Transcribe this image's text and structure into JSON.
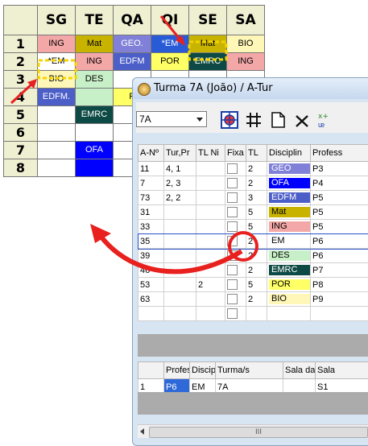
{
  "timetable": {
    "columns": [
      "SG",
      "TE",
      "QA",
      "QI",
      "SE",
      "SA"
    ],
    "rows": [
      {
        "label": "1",
        "cells": [
          {
            "text": "ING",
            "bg": "#f4a7a7"
          },
          {
            "text": "Mat",
            "bg": "#c8b400"
          },
          {
            "text": "GEO.",
            "bg": "#8080d8",
            "color": "#ffffff"
          },
          {
            "text": "*EM",
            "bg": "#2a5bd7",
            "color": "#ffffff"
          },
          {
            "text": "Mat",
            "bg": "#c8b400"
          },
          {
            "text": "BIO",
            "bg": "#fff7b8"
          }
        ]
      },
      {
        "label": "2",
        "cells": [
          {
            "text": "*EM",
            "bg": "#ffffff"
          },
          {
            "text": "ING",
            "bg": "#f4a7a7"
          },
          {
            "text": "EDFM",
            "bg": "#4c5ec8",
            "color": "#ffffff"
          },
          {
            "text": "POR",
            "bg": "#ffff66"
          },
          {
            "text": "EMRC",
            "bg": "#0e4a45",
            "color": "#ffffff"
          },
          {
            "text": "ING",
            "bg": "#f4a7a7"
          }
        ]
      },
      {
        "label": "3",
        "cells": [
          {
            "text": "BIO",
            "bg": "#fff7b8"
          },
          {
            "text": "DES",
            "bg": "#c8f0c8"
          },
          {
            "text": "",
            "bg": "#ffffff"
          },
          {
            "text": "",
            "bg": "#ffffff"
          },
          {
            "text": "",
            "bg": "#ffffff"
          },
          {
            "text": "",
            "bg": "#ffffff"
          }
        ]
      },
      {
        "label": "4",
        "cells": [
          {
            "text": "EDFM.",
            "bg": "#4c5ec8",
            "color": "#ffffff"
          },
          {
            "text": "",
            "bg": "#c8f0c8"
          },
          {
            "text": "P",
            "bg": "#ffff66"
          },
          {
            "text": "",
            "bg": "#ffffff"
          },
          {
            "text": "",
            "bg": "#ffffff"
          },
          {
            "text": "",
            "bg": "#ffffff"
          }
        ]
      },
      {
        "label": "5",
        "cells": [
          {
            "text": "",
            "bg": "#ffffff"
          },
          {
            "text": "EMRC",
            "bg": "#0e4a45",
            "color": "#ffffff"
          },
          {
            "text": "",
            "bg": "#ffffff"
          },
          {
            "text": "",
            "bg": "#ffffff"
          },
          {
            "text": "",
            "bg": "#ffffff"
          },
          {
            "text": "",
            "bg": "#ffffff"
          }
        ]
      },
      {
        "label": "6",
        "cells": [
          {
            "text": "",
            "bg": "#ffffff"
          },
          {
            "text": "",
            "bg": "#ffffff"
          },
          {
            "text": "",
            "bg": "#ffffff"
          },
          {
            "text": "",
            "bg": "#ffffff"
          },
          {
            "text": "",
            "bg": "#ffffff"
          },
          {
            "text": "",
            "bg": "#ffffff"
          }
        ]
      },
      {
        "label": "7",
        "cells": [
          {
            "text": "",
            "bg": "#ffffff"
          },
          {
            "text": "OFA",
            "bg": "#0000ff",
            "color": "#ffffff"
          },
          {
            "text": "",
            "bg": "#ffffff"
          },
          {
            "text": "",
            "bg": "#ffffff"
          },
          {
            "text": "",
            "bg": "#ffffff"
          },
          {
            "text": "",
            "bg": "#ffffff"
          }
        ]
      },
      {
        "label": "8",
        "cells": [
          {
            "text": "",
            "bg": "#ffffff"
          },
          {
            "text": "",
            "bg": "#0000ff"
          },
          {
            "text": "",
            "bg": "#ffffff"
          },
          {
            "text": "",
            "bg": "#ffffff"
          },
          {
            "text": "",
            "bg": "#ffffff"
          },
          {
            "text": "",
            "bg": "#ffffff"
          }
        ]
      }
    ]
  },
  "dialog": {
    "title": "Turma 7A (João) / A-Tur",
    "class_select": "7A",
    "toolbar_icons": [
      "target-grid-icon",
      "hash-grid-icon",
      "new-document-icon",
      "delete-x-icon",
      "swap-icon"
    ],
    "lessons_headers": [
      "A-Nº",
      "Tur,Pr",
      "TL Ni",
      "Fixa",
      "TL",
      "Disciplin",
      "Profess"
    ],
    "lessons": [
      {
        "num": "11",
        "turpr": "4, 1",
        "tlni": "",
        "fixed": false,
        "tl": "2",
        "subject": "GEO",
        "subject_bg": "#8080d8",
        "subject_color": "#ffffff",
        "teacher": "P3"
      },
      {
        "num": "7",
        "turpr": "2, 3",
        "tlni": "",
        "fixed": false,
        "tl": "2",
        "subject": "OFA",
        "subject_bg": "#0000ff",
        "subject_color": "#ffffff",
        "teacher": "P4"
      },
      {
        "num": "73",
        "turpr": "2, 2",
        "tlni": "",
        "fixed": false,
        "tl": "3",
        "subject": "EDFM",
        "subject_bg": "#4c5ec8",
        "subject_color": "#ffffff",
        "teacher": "P5"
      },
      {
        "num": "31",
        "turpr": "",
        "tlni": "",
        "fixed": false,
        "tl": "5",
        "subject": "Mat",
        "subject_bg": "#c8b400",
        "subject_color": "#000000",
        "teacher": "P5"
      },
      {
        "num": "33",
        "turpr": "",
        "tlni": "",
        "fixed": false,
        "tl": "5",
        "subject": "ING",
        "subject_bg": "#f4a7a7",
        "subject_color": "#000000",
        "teacher": "P5"
      },
      {
        "num": "35",
        "turpr": "",
        "tlni": "",
        "fixed": true,
        "tl": "2",
        "subject": "EM",
        "subject_bg": "#ffffff",
        "subject_color": "#000000",
        "teacher": "P6"
      },
      {
        "num": "39",
        "turpr": "",
        "tlni": "",
        "fixed": false,
        "tl": "2",
        "subject": "DES",
        "subject_bg": "#c8f0c8",
        "subject_color": "#000000",
        "teacher": "P6"
      },
      {
        "num": "46",
        "turpr": "",
        "tlni": "",
        "fixed": false,
        "tl": "2",
        "subject": "EMRC",
        "subject_bg": "#0e4a45",
        "subject_color": "#ffffff",
        "teacher": "P7"
      },
      {
        "num": "53",
        "turpr": "",
        "tlni": "2",
        "fixed": false,
        "tl": "5",
        "subject": "POR",
        "subject_bg": "#ffff66",
        "subject_color": "#000000",
        "teacher": "P8"
      },
      {
        "num": "63",
        "turpr": "",
        "tlni": "",
        "fixed": false,
        "tl": "2",
        "subject": "BIO",
        "subject_bg": "#fff7b8",
        "subject_color": "#000000",
        "teacher": "P9"
      },
      {
        "num": "",
        "turpr": "",
        "tlni": "",
        "fixed": false,
        "tl": "",
        "subject": "",
        "subject_bg": "#ffffff",
        "subject_color": "#000000",
        "teacher": ""
      }
    ],
    "staff_headers": [
      "",
      "Profess",
      "Discip",
      "Turma/s",
      "Sala da",
      "Sala"
    ],
    "staff_rows": [
      {
        "idx": "1",
        "teacher": "P6",
        "subject": "EM",
        "class": "7A",
        "room_a": "",
        "room": "S1"
      }
    ],
    "scroll_thumb": "III"
  },
  "colors": {
    "arrow": "#e8201e",
    "highlight_dash": "#f5d400"
  }
}
